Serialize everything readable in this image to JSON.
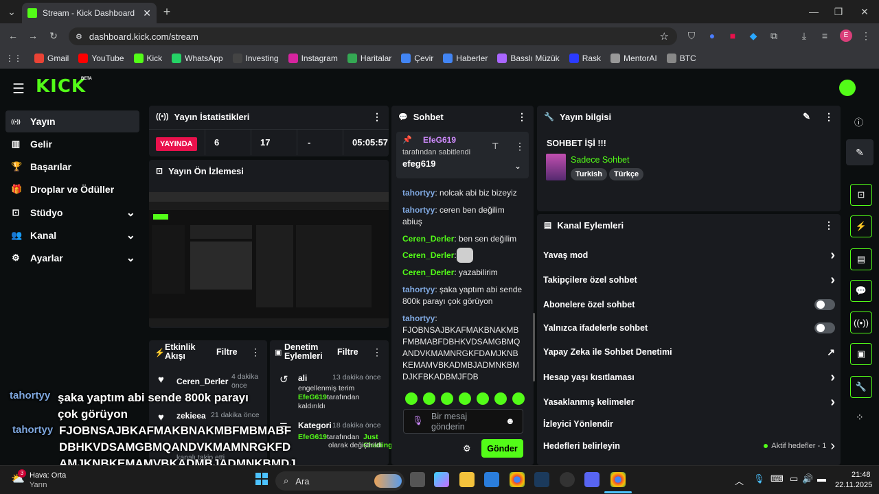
{
  "browser": {
    "tab_title": "Stream - Kick Dashboard",
    "url": "dashboard.kick.com/stream",
    "profile_initial": "E",
    "bookmarks": [
      {
        "label": "Gmail",
        "color": "#ea4335"
      },
      {
        "label": "YouTube",
        "color": "#ff0000"
      },
      {
        "label": "Kick",
        "color": "#53fc18"
      },
      {
        "label": "WhatsApp",
        "color": "#25d366"
      },
      {
        "label": "Investing",
        "color": "#444"
      },
      {
        "label": "Instagram",
        "color": "#d6249f"
      },
      {
        "label": "Haritalar",
        "color": "#34a853"
      },
      {
        "label": "Çevir",
        "color": "#4285f4"
      },
      {
        "label": "Haberler",
        "color": "#4285f4"
      },
      {
        "label": "Basslı Müzük",
        "color": "#aa66ff"
      },
      {
        "label": "Rask",
        "color": "#2b3bff"
      },
      {
        "label": "MentorAI",
        "color": "#999"
      },
      {
        "label": "BTC",
        "color": "#888"
      }
    ]
  },
  "header": {
    "logo": "KICK",
    "beta": "BETA"
  },
  "sidebar": {
    "items": [
      {
        "label": "Yayın",
        "icon": "broadcast-icon"
      },
      {
        "label": "Gelir",
        "icon": "revenue-icon"
      },
      {
        "label": "Başarılar",
        "icon": "trophy-icon"
      },
      {
        "label": "Droplar ve Ödüller",
        "icon": "gift-icon"
      },
      {
        "label": "Stüdyo",
        "icon": "studio-icon"
      },
      {
        "label": "Kanal",
        "icon": "channel-icon"
      },
      {
        "label": "Ayarlar",
        "icon": "gear-icon"
      }
    ]
  },
  "stats": {
    "title": "Yayın İstatistikleri",
    "live_badge": "YAYINDA",
    "viewers": "6",
    "followers": "17",
    "subs": "-",
    "uptime": "05:05:57"
  },
  "preview": {
    "title": "Yayın Ön İzlemesi"
  },
  "activity": {
    "title": "Etkinlik Akışı",
    "filter": "Filtre",
    "items": [
      {
        "user": "Ceren_Derler",
        "time": "4 dakika önce"
      },
      {
        "user": "zekieea",
        "time": "21 dakika önce",
        "sub": "kanalı takip etti"
      }
    ]
  },
  "moderation": {
    "title": "Denetim Eylemleri",
    "filter": "Filtre",
    "items": [
      {
        "title": "ali",
        "time": "13 dakika önce",
        "line1": "engellenmiş terim",
        "by": "EfeG619",
        "line2": "tarafından",
        "line3": "kaldırıldı"
      },
      {
        "title": "Kategori",
        "time": "18 dakika önce",
        "by": "EfeG619",
        "line2": "tarafından",
        "highlight": "Just Chatting",
        "line3": "olarak değiştirildi"
      }
    ]
  },
  "chat": {
    "title": "Sohbet",
    "pinned_user": "EfeG619",
    "pinned_by": "tarafından sabitlendi",
    "pinned_msg": "efeg619",
    "messages": [
      {
        "user": "tahortyy",
        "text": "nolcak abi biz bizeyiz",
        "color": "#7fa8e0"
      },
      {
        "user": "tahortyy",
        "text": "ceren ben değilim abiuş",
        "color": "#7fa8e0"
      },
      {
        "user": "Ceren_Derler",
        "text": "ben sen değilim",
        "color": "#53fc18"
      },
      {
        "user": "Ceren_Derler",
        "text": "",
        "color": "#53fc18"
      },
      {
        "user": "Ceren_Derler",
        "text": "yazabilirim",
        "color": "#53fc18"
      },
      {
        "user": "tahortyy",
        "text": "şaka yaptım abi sende 800k parayı çok görüyon",
        "color": "#7fa8e0"
      },
      {
        "user": "tahortyy",
        "text": "FJOBNSAJBKAFMAKBNAKMBFMBMABFDBHKVDSAMGBMQANDVKMAMNRGKFDAMJKNBKEMAMVBKADMBJADMNKBMDJKFBKADBMJFDB",
        "color": "#7fa8e0"
      }
    ],
    "input_placeholder": "Bir mesaj gönderin",
    "send_label": "Gönder"
  },
  "stream_info": {
    "title": "Yayın bilgisi",
    "stream_title": "SOHBET İŞİ !!!",
    "category": "Sadece Sohbet",
    "tags": [
      "Turkish",
      "Türkçe"
    ]
  },
  "channel_actions": {
    "title": "Kanal Eylemleri",
    "rows": [
      {
        "label": "Yavaş mod",
        "kind": "arrow"
      },
      {
        "label": "Takipçilere özel sohbet",
        "kind": "arrow"
      },
      {
        "label": "Abonelere özel sohbet",
        "kind": "toggle"
      },
      {
        "label": "Yalnızca ifadelerle sohbet",
        "kind": "toggle"
      },
      {
        "label": "Yapay Zeka ile Sohbet Denetimi",
        "kind": "external"
      },
      {
        "label": "Hesap yaşı kısıtlaması",
        "kind": "arrow"
      },
      {
        "label": "Yasaklanmış kelimeler",
        "kind": "arrow"
      },
      {
        "label": "İzleyici Yönlendir",
        "kind": "none"
      },
      {
        "label": "Hedefleri belirleyin",
        "kind": "goals",
        "extra": "Aktif hedefler - 1"
      }
    ]
  },
  "overlay": {
    "line1_user": "tahortyy",
    "line1_text": "şaka yaptım abi sende 800k parayı çok görüyon",
    "line2_user": "tahortyy",
    "line2_text": "FJOBNSAJBKAFMAKBNAKMBFMBMABFDBHKVDSAMGBMQANDVKMAMNRGKFDAMJKNBKEMAMVBKADMBJADMNKBMDJKFBKADBMJFD"
  },
  "taskbar": {
    "weather_line1": "Hava: Orta",
    "weather_line2": "Yarın",
    "weather_badge": "3",
    "search": "Ara",
    "time": "21:48",
    "date": "22.11.2025"
  },
  "colors": {
    "accent": "#53fc18",
    "live": "#e9114c",
    "chat_blue": "#7fa8e0"
  }
}
